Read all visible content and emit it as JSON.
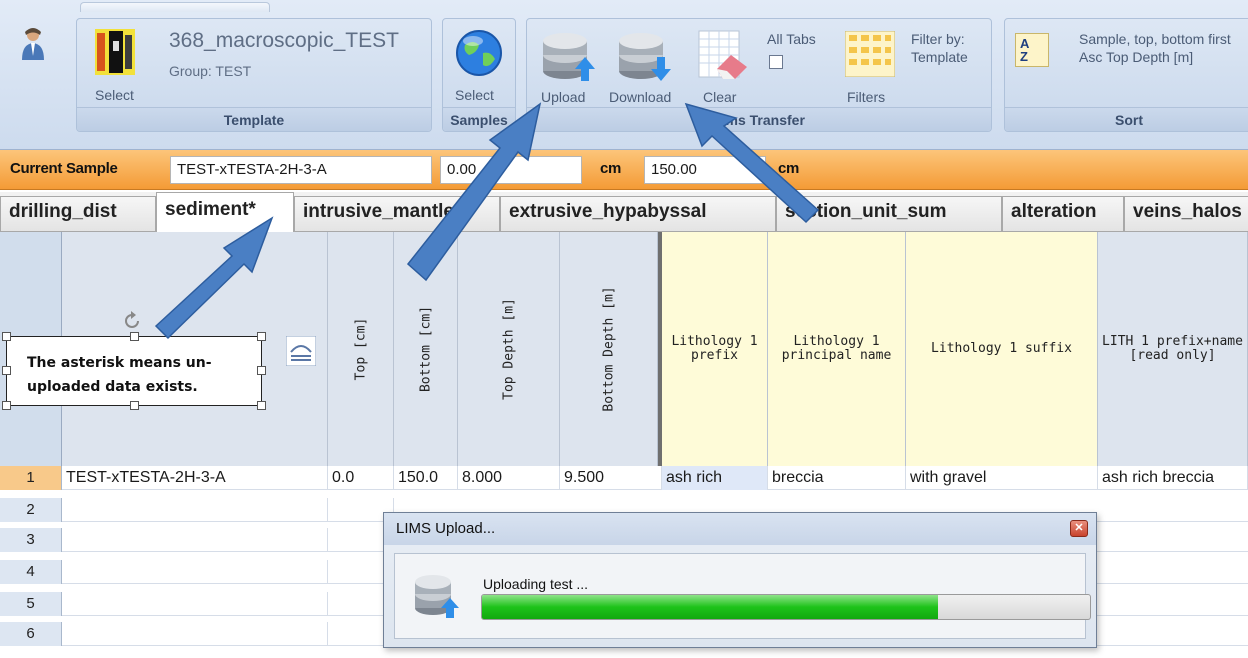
{
  "ribbon": {
    "template_group": {
      "select_label": "Select",
      "template_name": "368_macroscopic_TEST",
      "group_text": "Group: TEST",
      "label": "Template"
    },
    "samples_group": {
      "select_label": "Select",
      "label": "Samples"
    },
    "transfer_group": {
      "upload_label": "Upload",
      "download_label": "Download",
      "clear_label": "Clear",
      "all_tabs_label": "All Tabs",
      "filters_label": "Filters",
      "filter_by_label": "Filter by:",
      "filter_by_value": "Template",
      "label": "Lims Transfer"
    },
    "sort_group": {
      "line1": "Sample, top, bottom first",
      "line2": "Asc Top Depth [m]",
      "label": "Sort"
    }
  },
  "current_sample": {
    "label": "Current Sample",
    "value": "TEST-xTESTA-2H-3-A",
    "top_value": "0.00",
    "unit1": "cm",
    "bottom_value": "150.00",
    "unit2": "cm"
  },
  "tabs": [
    {
      "label": "drilling_dist",
      "active": false
    },
    {
      "label": "sediment*",
      "active": true
    },
    {
      "label": "intrusive_mantle",
      "active": false
    },
    {
      "label": "extrusive_hypabyssal",
      "active": false
    },
    {
      "label": "section_unit_sum",
      "active": false
    },
    {
      "label": "alteration",
      "active": false
    },
    {
      "label": "veins_halos",
      "active": false
    }
  ],
  "columns": {
    "top": "Top [cm]",
    "bottom": "Bottom [cm]",
    "top_depth": "Top Depth [m]",
    "bottom_depth": "Bottom Depth [m]",
    "lith_prefix": "Lithology 1 prefix",
    "lith_principal": "Lithology 1 principal name",
    "lith_suffix": "Lithology 1 suffix",
    "lith_combined": "LITH 1 prefix+name [read only]"
  },
  "rows": [
    {
      "num": "1",
      "sample": "TEST-xTESTA-2H-3-A",
      "top": "0.0",
      "bottom": "150.0",
      "top_depth": "8.000",
      "bottom_depth": "9.500",
      "prefix": "ash rich",
      "principal": "breccia",
      "suffix": "with gravel",
      "combined": "ash rich breccia"
    },
    {
      "num": "2",
      "sample": "",
      "top": "",
      "bottom": "",
      "top_depth": "",
      "bottom_depth": "",
      "prefix": "",
      "principal": "",
      "suffix": "",
      "combined": ""
    },
    {
      "num": "3",
      "sample": "",
      "top": "",
      "bottom": "",
      "top_depth": "",
      "bottom_depth": "",
      "prefix": "",
      "principal": "",
      "suffix": "",
      "combined": ""
    },
    {
      "num": "4",
      "sample": "",
      "top": "",
      "bottom": "",
      "top_depth": "",
      "bottom_depth": "",
      "prefix": "",
      "principal": "",
      "suffix": "",
      "combined": ""
    },
    {
      "num": "5",
      "sample": "",
      "top": "",
      "bottom": "",
      "top_depth": "",
      "bottom_depth": "",
      "prefix": "",
      "principal": "",
      "suffix": "",
      "combined": ""
    },
    {
      "num": "6",
      "sample": "",
      "top": "",
      "bottom": "",
      "top_depth": "",
      "bottom_depth": "",
      "prefix": "",
      "principal": "",
      "suffix": "",
      "combined": ""
    }
  ],
  "callout": {
    "line1": "The asterisk means un-",
    "line2": "uploaded data exists."
  },
  "dialog": {
    "title": "LIMS Upload...",
    "message": "Uploading test ...",
    "progress": 0.75,
    "close_icon": "close-icon"
  },
  "colors": {
    "sample_bar": "#f49b36",
    "arrow": "#4a7fc4",
    "progress": "#1ec31a",
    "yellow_columns": "#fefbd8"
  }
}
